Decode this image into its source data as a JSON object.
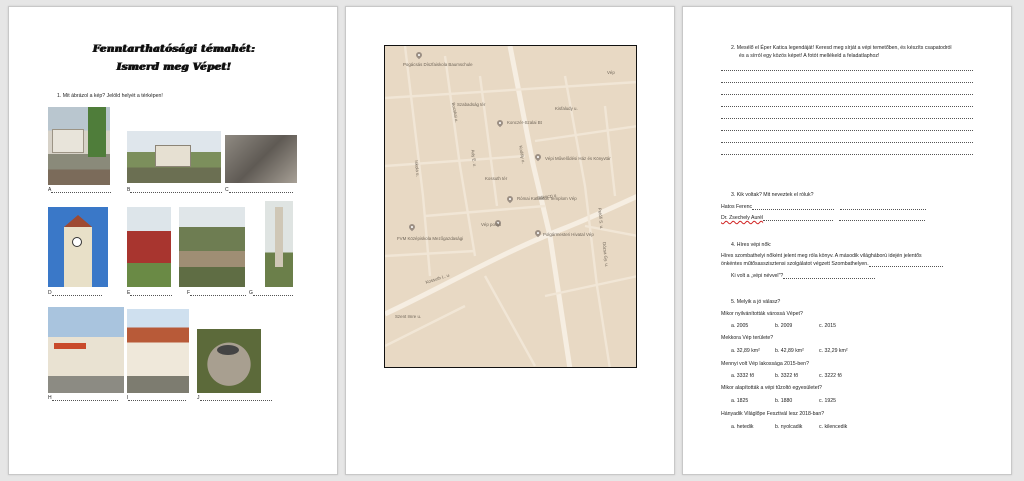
{
  "page1": {
    "title_line1": "Fenntarthatósági témahét:",
    "title_line2": "Ismerd meg Vépet!",
    "q1": "1.   Mit ábrázol a kép? Jelöld helyét a térképen!",
    "labels": [
      "A",
      "B",
      "C",
      "D",
      "E",
      "F",
      "G",
      "H",
      "I",
      "J"
    ]
  },
  "page2": {
    "map_labels": [
      "Pogácsás Díszfaiskola Baumschule",
      "Vép",
      "Konczér-Szalai Bt",
      "Vépi Művelődési Ház és Könyvtár",
      "Római Katolikus Templom Vép",
      "FVM Középiskola Mezőgazdasági",
      "Vép posta",
      "Polgármesteri Hivatal Vép",
      "Kossuth L. u.",
      "Rákóczi u.",
      "Szent Imre u.",
      "Kodály u.",
      "Petőfi S. u.",
      "Dózsa Gy. u.",
      "Bocskai u.",
      "Szabadság tér",
      "Ady E. u.",
      "Kossuth tér",
      "Iskola u.",
      "Kisfaludy u."
    ]
  },
  "page3": {
    "q2_line1": "2.   Mesélő el Éper Katica legendáját! Keresd meg sírját a vépi temetőben, és készíts csapatodról",
    "q2_line2": "és a sírról egy közös képet! A fotót mellékeld a feladatlaphoz!",
    "q3": "3.   Kik voltak? Mit neveztek el róluk?",
    "q3_a": "Hatos Ferenc",
    "q3_b": "Dr. Zsechely Aurél",
    "q4": "4.   Híres vépi nők:",
    "q4_text1": "Híres szombathelyi nőként jelent meg róla könyv. A második világháború idején jelentős",
    "q4_text2": "önkéntes műtősasszisztensi szolgálatot végzett Szombathelyen.",
    "q4_text3": "Ki volt a „vépi névvel\"?",
    "q5": "5.   Melyik a jó válasz?",
    "items": [
      {
        "question": "Mikor nyilvánították várossá Vépet?",
        "a": "a.    2005",
        "b": "b. 2009",
        "c": "c. 2015"
      },
      {
        "question": "Mekkora Vép területe?",
        "a": "a.    32,89 km²",
        "b": "b. 42,89 km²",
        "c": "c. 32,29 km²"
      },
      {
        "question": "Mennyi volt Vép lakossága 2015-ben?",
        "a": "a.    3332 fő",
        "b": "b. 3322 fő",
        "c": "c. 3222 fő"
      },
      {
        "question": "Mikor alapították a vépi tűzoltó egyesületet?",
        "a": "a.    1825",
        "b": "b. 1880",
        "c": "c. 1925"
      },
      {
        "question": "Hányadik Világlőpe Fesztivál lesz 2018-ban?",
        "a": "a.    hetedik",
        "b": "b. nyolcadik",
        "c": "c. kilencedik"
      }
    ]
  }
}
